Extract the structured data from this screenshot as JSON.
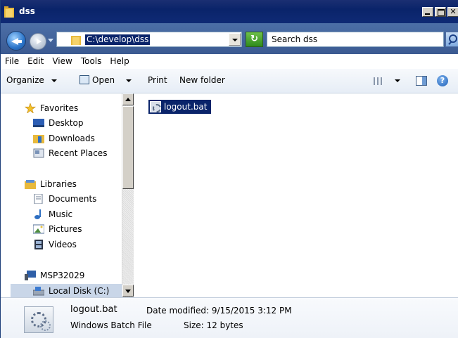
{
  "window": {
    "title": "dss"
  },
  "address": {
    "path": "C:\\develop\\dss",
    "refresh_glyph": "↻"
  },
  "search": {
    "placeholder": "Search dss"
  },
  "menu": [
    "File",
    "Edit",
    "View",
    "Tools",
    "Help"
  ],
  "commands": {
    "organize": "Organize",
    "open": "Open",
    "print": "Print",
    "new_folder": "New folder",
    "help_glyph": "?"
  },
  "nav": {
    "favorites": "Favorites",
    "desktop": "Desktop",
    "downloads": "Downloads",
    "recent": "Recent Places",
    "libraries": "Libraries",
    "documents": "Documents",
    "music": "Music",
    "pictures": "Pictures",
    "videos": "Videos",
    "computer": "MSP32029",
    "local_disk": "Local Disk (C:)"
  },
  "files": [
    {
      "name": "logout.bat"
    }
  ],
  "details": {
    "name": "logout.bat",
    "type": "Windows Batch File",
    "modified": "Date modified: 9/15/2015 3:12 PM",
    "size": "Size: 12 bytes"
  },
  "colors": {
    "selection": "#0a246a",
    "titlebar": "#0a246a",
    "address_band": "#3b5a91"
  }
}
